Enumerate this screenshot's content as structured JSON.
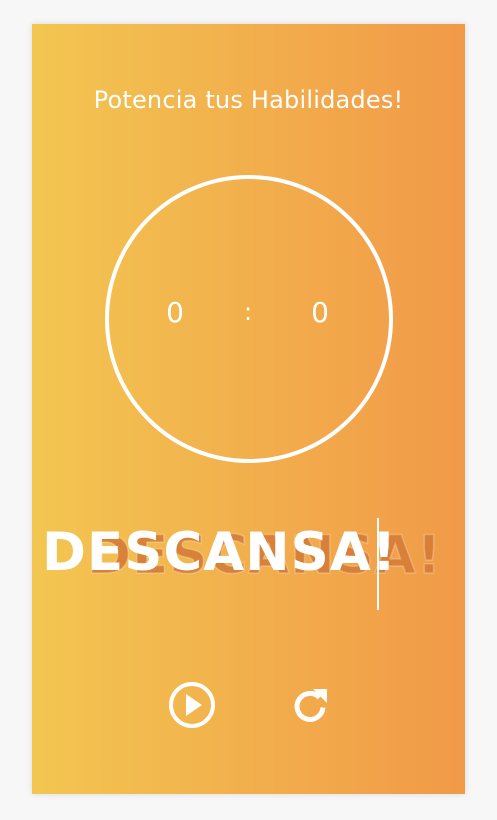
{
  "app": {
    "title": "Potencia tus Habilidades!"
  },
  "timer": {
    "minutes": "0",
    "separator": ":",
    "seconds": "0"
  },
  "status": {
    "label": "DESCANSA!"
  },
  "controls": {
    "play_icon": "play-circle-icon",
    "reset_icon": "rotate-clockwise-icon"
  },
  "colors": {
    "gradient_start": "#f3c651",
    "gradient_end": "#f19a48",
    "foreground": "#ffffff",
    "ghost_text": "#d67d36",
    "page_background": "#f7f7f7"
  }
}
